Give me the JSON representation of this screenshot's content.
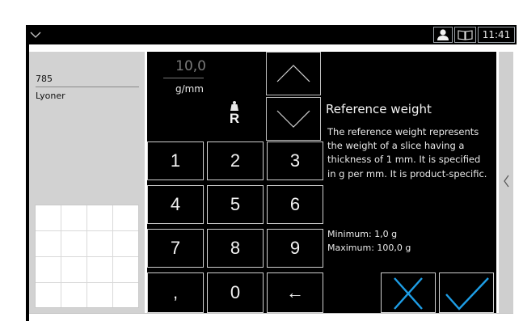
{
  "topbar": {
    "time": "11:41",
    "icons": [
      "chevron-down-icon",
      "user-icon",
      "book-icon"
    ]
  },
  "left_panel": {
    "item_number": "785",
    "item_name": "Lyoner"
  },
  "keypad": {
    "value": "10,0",
    "unit": "g/mm",
    "reference_symbol": "R",
    "keys": [
      "1",
      "2",
      "3",
      "4",
      "5",
      "6",
      "7",
      "8",
      "9",
      ",",
      "0",
      "←"
    ]
  },
  "info": {
    "title": "Reference weight",
    "body": "The reference weight represents the weight of a slice having a thickness of 1 mm. It is specified in g per mm. It is product-specific.",
    "minimum": "Minimum: 1,0 g",
    "maximum": "Maximum: 100,0 g"
  },
  "colors": {
    "accent": "#1e9ee6",
    "panel_bg": "#d2d2d2",
    "dark_bg": "#000000"
  }
}
